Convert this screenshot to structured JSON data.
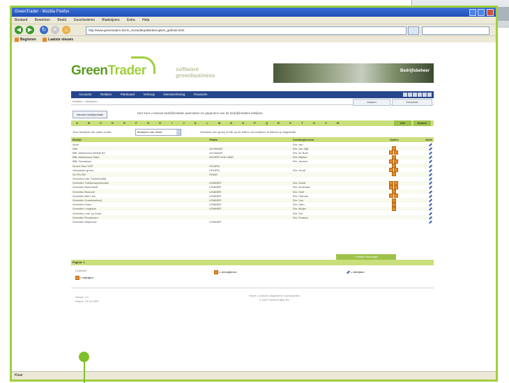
{
  "window": {
    "title": "GreenTrader - Mozilla Firefox",
    "menu": [
      "Bestand",
      "Bewerken",
      "Beeld",
      "Geschiedenis",
      "Bladwijzers",
      "Extra",
      "Help"
    ],
    "address": "http://www.greentrader.nl/crm_veranderpakkettenopties_gebruik.html",
    "bookmarks": [
      "Beginnen",
      "Laatste nieuws"
    ],
    "status": "Klaar"
  },
  "site": {
    "logo_green": "Green",
    "logo_trader": "Trader",
    "tagline_1": "software",
    "tagline_2": "greenbusiness",
    "photo_label": "Bedrijfsbeheer",
    "nav": [
      "Accounts",
      "Relaties",
      "Planboard",
      "Verkoop",
      "Dienstverlening",
      "Financiën"
    ],
    "breadcrumb": "Relaties > Bedrijven",
    "sub_buttons": [
      "Zoeken",
      "Overzicht"
    ],
    "overview_button": "Nieuwe bedrijfsrelatie",
    "intro": "Hier kunt u nieuwe bedrijfsrelaties aanmaken en gegevens van de bedrijfsrelaties bekijken.",
    "alphabet": [
      "A",
      "B",
      "C",
      "D",
      "E",
      "F",
      "G",
      "H",
      "I",
      "J",
      "K",
      "L",
      "M",
      "N",
      "O",
      "P",
      "Q",
      "R",
      "S",
      "T",
      "U",
      "V",
      "W"
    ],
    "alle": "Alle",
    "andere": "Andere",
    "filter_label": "Toon bedrijven die vallen onder:",
    "filter_value": "Bedrijven van derde",
    "filter_hint": "Selecteer een groep of klik op de letters om bedrijven te filteren op beginletter.",
    "columns": [
      "Bedrijf",
      "Plaats",
      "Contactpersoon",
      "Opties",
      "Actie"
    ],
    "rows": [
      [
        "Aeon",
        "",
        "Dhr. van",
        ""
      ],
      [
        "Alfa",
        "ALKMAAR",
        "Dhr. van Dijk",
        "1"
      ],
      [
        "BBL Akkerbouw Bedrijf BV",
        "ALKMAAR",
        "Dhr. de Boer",
        "2"
      ],
      [
        "BBL Akkerbouw Stam",
        "NOORD HOLLAND",
        "Dhr. Bakker",
        "1"
      ],
      [
        "BBL Gewassen",
        "",
        "Dhr. Jansen",
        "2"
      ],
      [
        "Groen Dico VOF",
        "HOORN",
        "",
        "1"
      ],
      [
        "Gewassen groen",
        "HOORN",
        "Dhr. Groot",
        "2"
      ],
      [
        "Go Pro BV",
        "EDAM",
        "",
        "1"
      ],
      [
        "Greenhof van Tuinenbedrijf",
        "",
        "",
        ""
      ],
      [
        "Greenbiz Tuinbouwproducten",
        "LEMMER",
        "Dhr. Zwart",
        "2"
      ],
      [
        "Greenbiz Bloemteelt",
        "LEMMER",
        "Dhr. Molenaar",
        "2"
      ],
      [
        "Greenbiz Broccoli",
        "LEMMER",
        "Dhr. Smit",
        "1"
      ],
      [
        "Greenbiz Biet Leer",
        "LEMMER",
        "Dhr. Hofman",
        "2"
      ],
      [
        "Greenbiz Grootkwekerij",
        "LEMMER",
        "Dhr. Vos",
        "1"
      ],
      [
        "Greenbiz Kolen",
        "LEMMER",
        "Dhr. Dam",
        "1"
      ],
      [
        "Greenbiz Lenglade",
        "LEMMER",
        "Dhr. Meijer",
        "1"
      ],
      [
        "Greenbiz Leer op Zand",
        "",
        "Dhr. Wit",
        ""
      ],
      [
        "Greenbiz Roosboom",
        "",
        "Dhr. Postma",
        ""
      ],
      [
        "Greenbiz Wijnbouw",
        "LEMMER",
        "",
        ""
      ]
    ],
    "pager": "Pagina: 1",
    "add_link": "+ Bedrijf toevoegen",
    "legend_small": "Legenda",
    "legend_1": "= wijzigen",
    "legend_2": "= verwijderen",
    "legend_3": "= bekijken",
    "foot_left_1": "Versie: 3.4",
    "foot_left_2": "Datum: 23-10-2007",
    "foot_center_1": "Home | Contact | Algemene voorwaarden",
    "foot_center_2": "© 2007 GreenTrader BV"
  }
}
